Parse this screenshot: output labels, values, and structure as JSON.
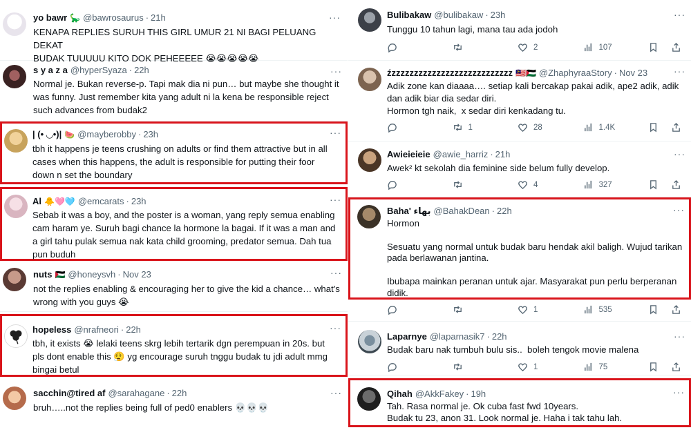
{
  "left": [
    {
      "name": "yo bawr",
      "emoji": "🦕",
      "handle": "@bawrosaurus",
      "time": "21h",
      "text": "KENAPA REPLIES SURUH THIS GIRL UMUR 21 NI BAGI PELUANG DEKAT\nBUDAK TUUUUU KITO DOK PEHEEEEE 😭😭😭😭😭"
    },
    {
      "name": "s y a z a",
      "emoji": "",
      "handle": "@hyperSyaza",
      "time": "22h",
      "text": "Normal je. Bukan reverse-p. Tapi mak dia ni pun… but maybe she thought it\nwas funny. Just remember kita yang adult ni la kena be responsible reject\nsuch advances from budak2"
    },
    {
      "name": "| (• ◡•)|",
      "emoji": "🍉",
      "handle": "@mayberobby",
      "time": "23h",
      "text": "tbh it happens je teens crushing on adults or find them attractive but in all\ncases when this happens, the adult is responsible for putting their foor\ndown n set the boundary"
    },
    {
      "name": "Al",
      "emoji": "🐥🩷🩵",
      "handle": "@emcarats",
      "time": "23h",
      "text": "Sebab it was a boy, and the poster is a woman, yang reply semua enabling\ncam haram ye. Suruh bagi chance la hormone la bagai. If it was a man and\na girl tahu pulak semua nak kata child grooming, predator semua. Dah tua\npun buduh"
    },
    {
      "name": "nuts",
      "emoji": "🇵🇸",
      "handle": "@honeysvh",
      "time": "Nov 23",
      "text": "not the replies enabling & encouraging her to give the kid a chance… what's\nwrong with you guys 😭"
    },
    {
      "name": "hopeless",
      "emoji": "",
      "handle": "@nrafneori",
      "time": "22h",
      "text": "tbh, it exists 😭 lelaki teens skrg lebih tertarik dgn perempuan in 20s. but\npls dont enable this 😮‍💨 yg encourage suruh tnggu budak tu jdi adult mmg\nbingai betul"
    },
    {
      "name": "sacchin@tired af",
      "emoji": "",
      "handle": "@sarahagane",
      "time": "22h",
      "text": "bruh…..not the replies being full of ped0 enablers 💀💀💀"
    }
  ],
  "right": [
    {
      "name": "Bulibakaw",
      "emoji": "",
      "handle": "@bulibakaw",
      "time": "23h",
      "text": "Tunggu 10 tahun lagi, mana tau ada jodoh",
      "stats": {
        "replies": "",
        "retweets": "",
        "likes": "2",
        "views": "107"
      }
    },
    {
      "name": "źzzzzzzzzzzzzzzzzzzzzzzzzzzz",
      "emoji": "🇲🇾🇵🇸",
      "handle": "@ZhaphyraaStory",
      "time": "Nov 23",
      "text": "Adik zone kan diaaaa…. setiap kali bercakap pakai adik, ape2 adik, adik\ndan adik biar dia sedar diri.\nHormon tgh naik,  x sedar diri kenkadang tu.",
      "stats": {
        "replies": "",
        "retweets": "1",
        "likes": "28",
        "views": "1.4K"
      }
    },
    {
      "name": "Awieieieie",
      "emoji": "",
      "handle": "@awie_harriz",
      "time": "21h",
      "text": "Awek² kt sekolah dia feminine side belum fully develop.",
      "stats": {
        "replies": "",
        "retweets": "",
        "likes": "4",
        "views": "327"
      }
    },
    {
      "name": "Baha' بهاء",
      "emoji": "",
      "handle": "@BahakDean",
      "time": "22h",
      "text": "Hormon\n\nSesuatu yang normal untuk budak baru hendak akil baligh. Wujud tarikan\npada berlawanan jantina.\n\nIbubapa mainkan peranan untuk ajar. Masyarakat pun perlu berperanan\ndidik.",
      "stats": {
        "replies": "",
        "retweets": "",
        "likes": "1",
        "views": "535"
      }
    },
    {
      "name": "Laparnye",
      "emoji": "",
      "handle": "@laparnasik7",
      "time": "22h",
      "text": "Budak baru nak tumbuh bulu sis..  boleh tengok movie malena",
      "stats": {
        "replies": "",
        "retweets": "",
        "likes": "1",
        "views": "75"
      }
    },
    {
      "name": "Qihah",
      "emoji": "",
      "handle": "@AkkFakey",
      "time": "19h",
      "text": "Tah. Rasa normal je. Ok cuba fast fwd 10years.\nBudak tu 23, anon 31. Look normal je. Haha i tak tahu lah.",
      "stats": {}
    }
  ],
  "more_label": "···",
  "colors": {
    "highlight_border": "#d9141b",
    "secondary_text": "#536471",
    "primary_text": "#0f1419"
  }
}
